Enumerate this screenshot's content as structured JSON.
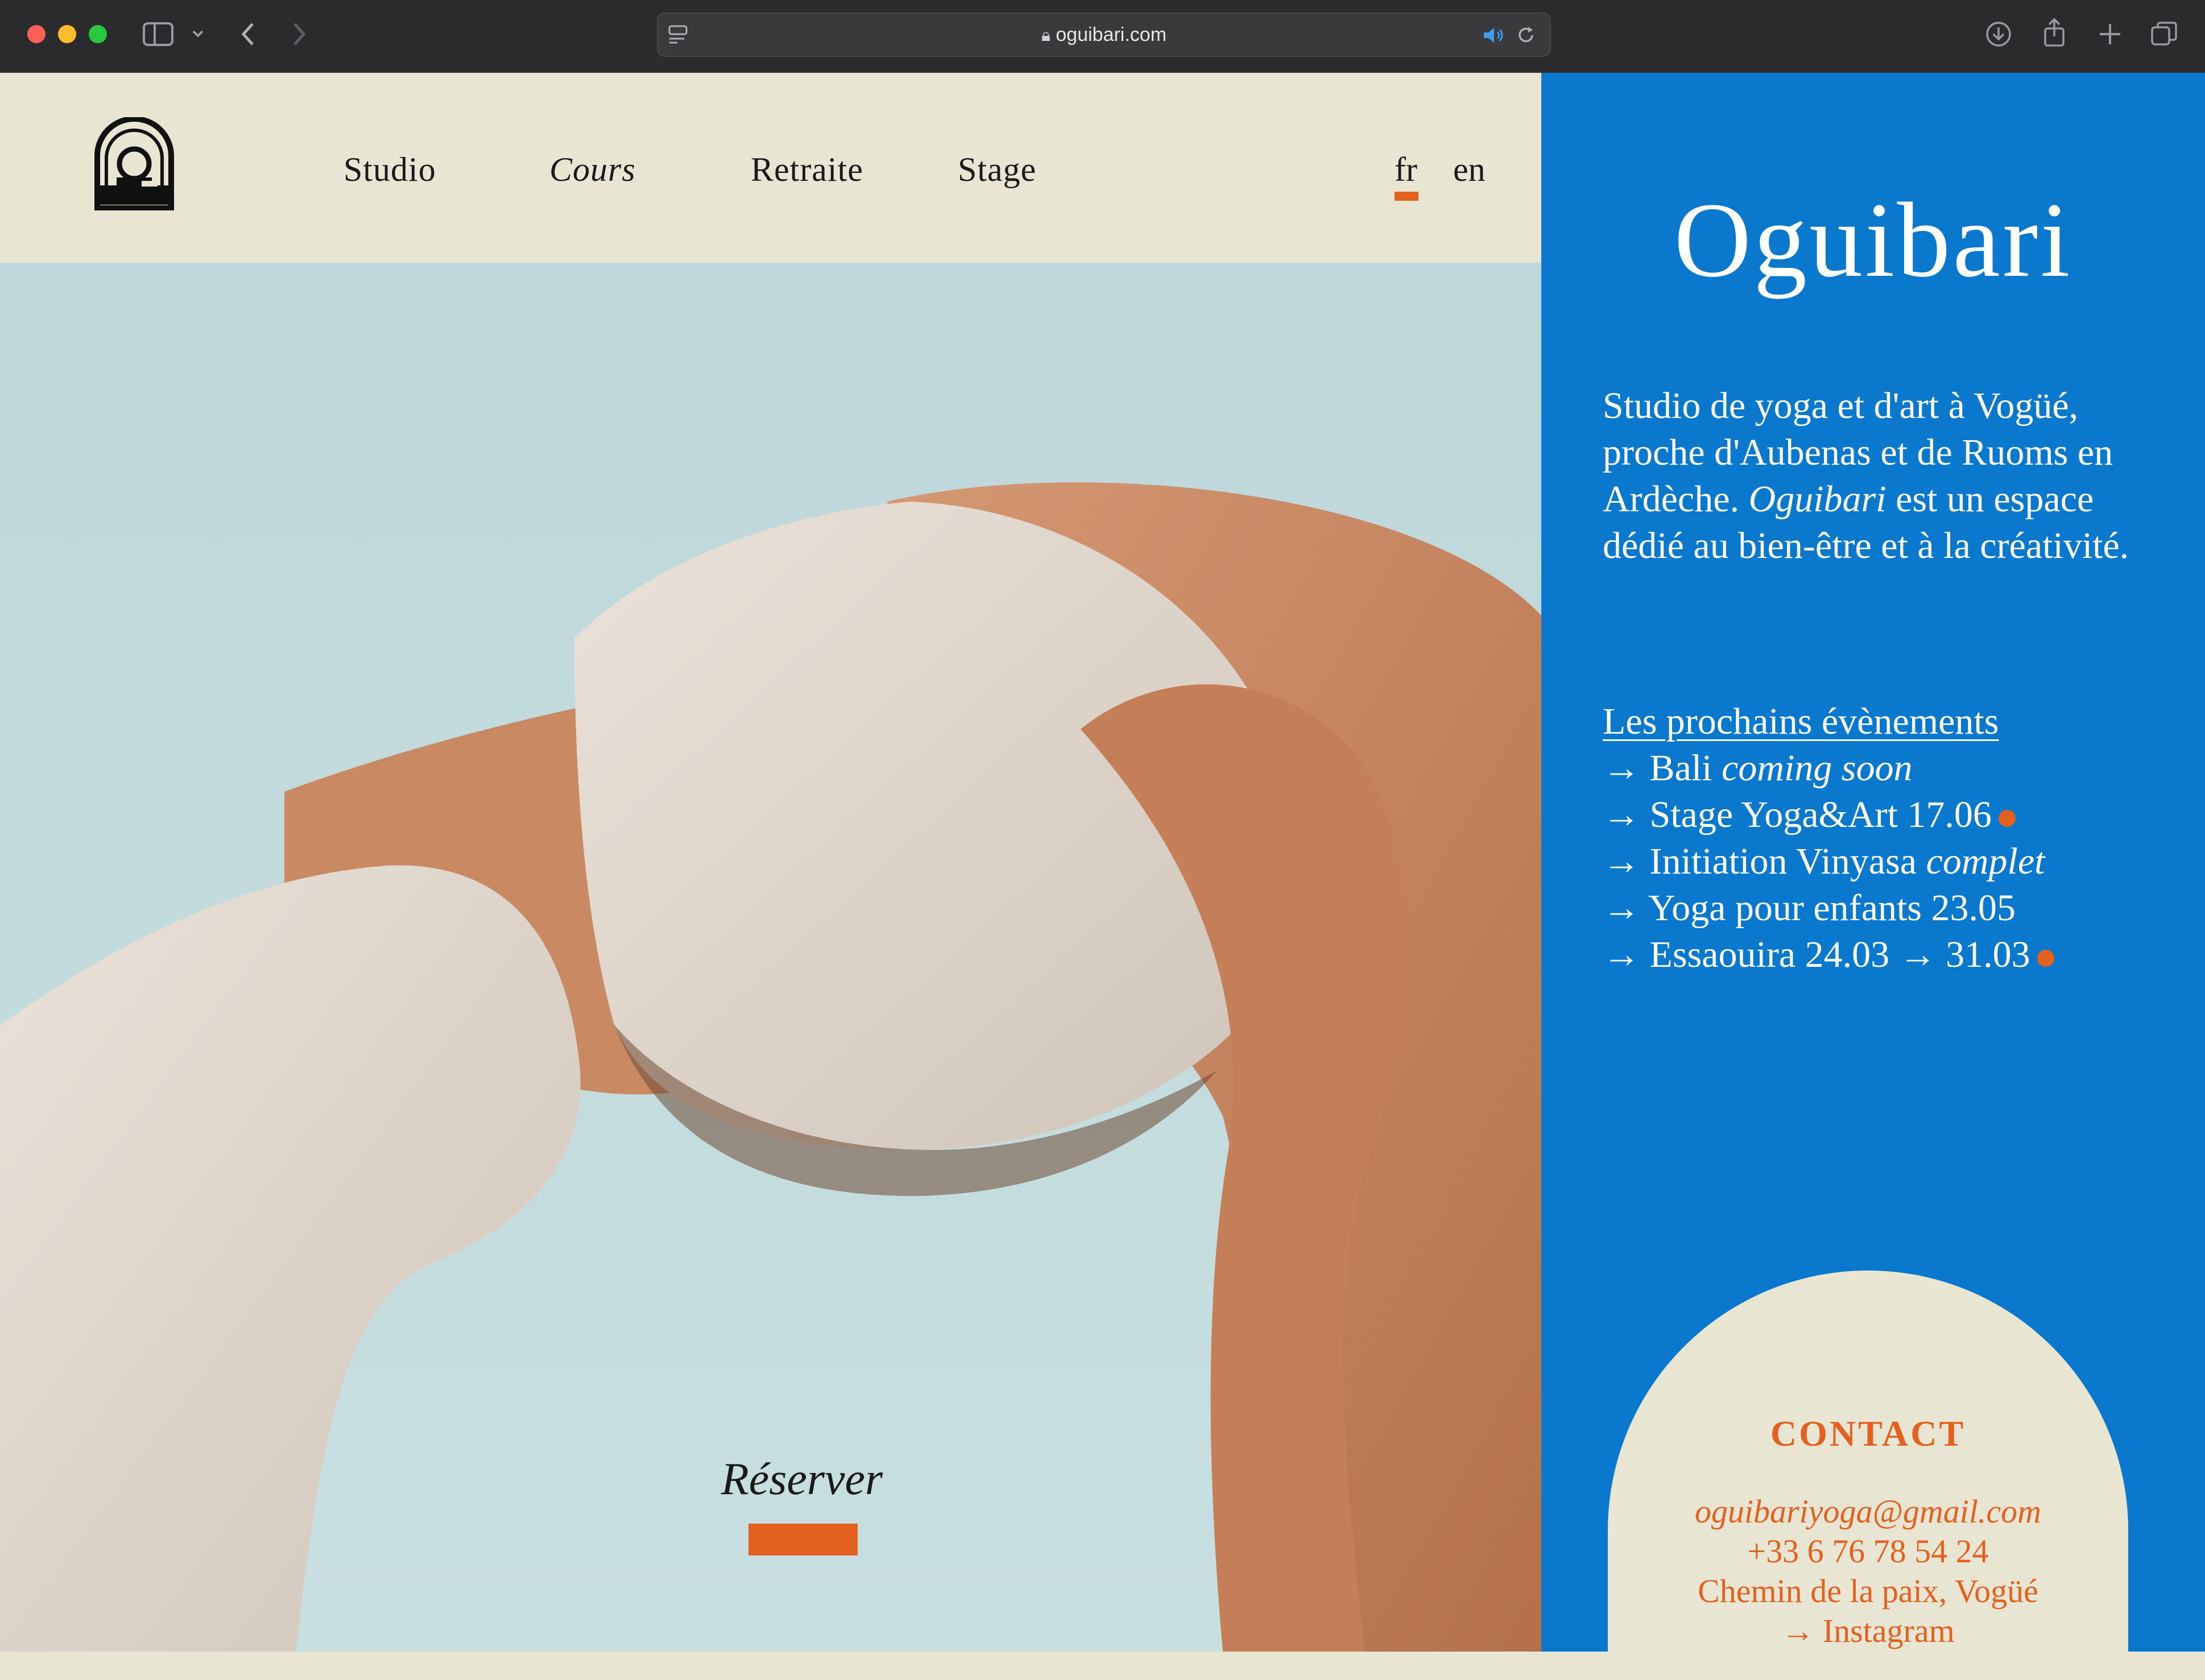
{
  "browser": {
    "url": "oguibari.com"
  },
  "nav": {
    "items": [
      "Studio",
      "Cours",
      "Retraite",
      "Stage"
    ],
    "lang_fr": "fr",
    "lang_en": "en",
    "active_lang": "fr"
  },
  "hero": {
    "reserve_label": "Réserver"
  },
  "brand": {
    "title": "Oguibari"
  },
  "intro": {
    "text_before": "Studio de yoga et d'art à Vogüé, proche d'Aubenas et de Ruoms en Ardèche. ",
    "emphasis": "Oguibari",
    "text_after": " est un espace dédié au bien-être et à la créativité."
  },
  "events": {
    "title": "Les prochains évènements",
    "arrow": "→",
    "items": [
      {
        "label": "Bali",
        "note": "coming soon",
        "dot": false
      },
      {
        "label": "Stage Yoga&Art 17.06",
        "note": "",
        "dot": true
      },
      {
        "label": "Initiation Vinyasa",
        "note": "complet",
        "dot": false
      },
      {
        "label": "Yoga pour enfants 23.05",
        "note": "",
        "dot": false
      },
      {
        "label": "Essaouira 24.03 → 31.03",
        "note": "",
        "dot": true
      }
    ]
  },
  "contact": {
    "title": "CONTACT",
    "email": "oguibariyoga@gmail.com",
    "phone": "+33 6 76 78 54 24",
    "address": "Chemin de la paix, Vogüé",
    "instagram": "→ Instagram"
  },
  "colors": {
    "accent": "#e3601f",
    "panel_blue": "#0a78cc",
    "cream": "#e8e5d3"
  }
}
